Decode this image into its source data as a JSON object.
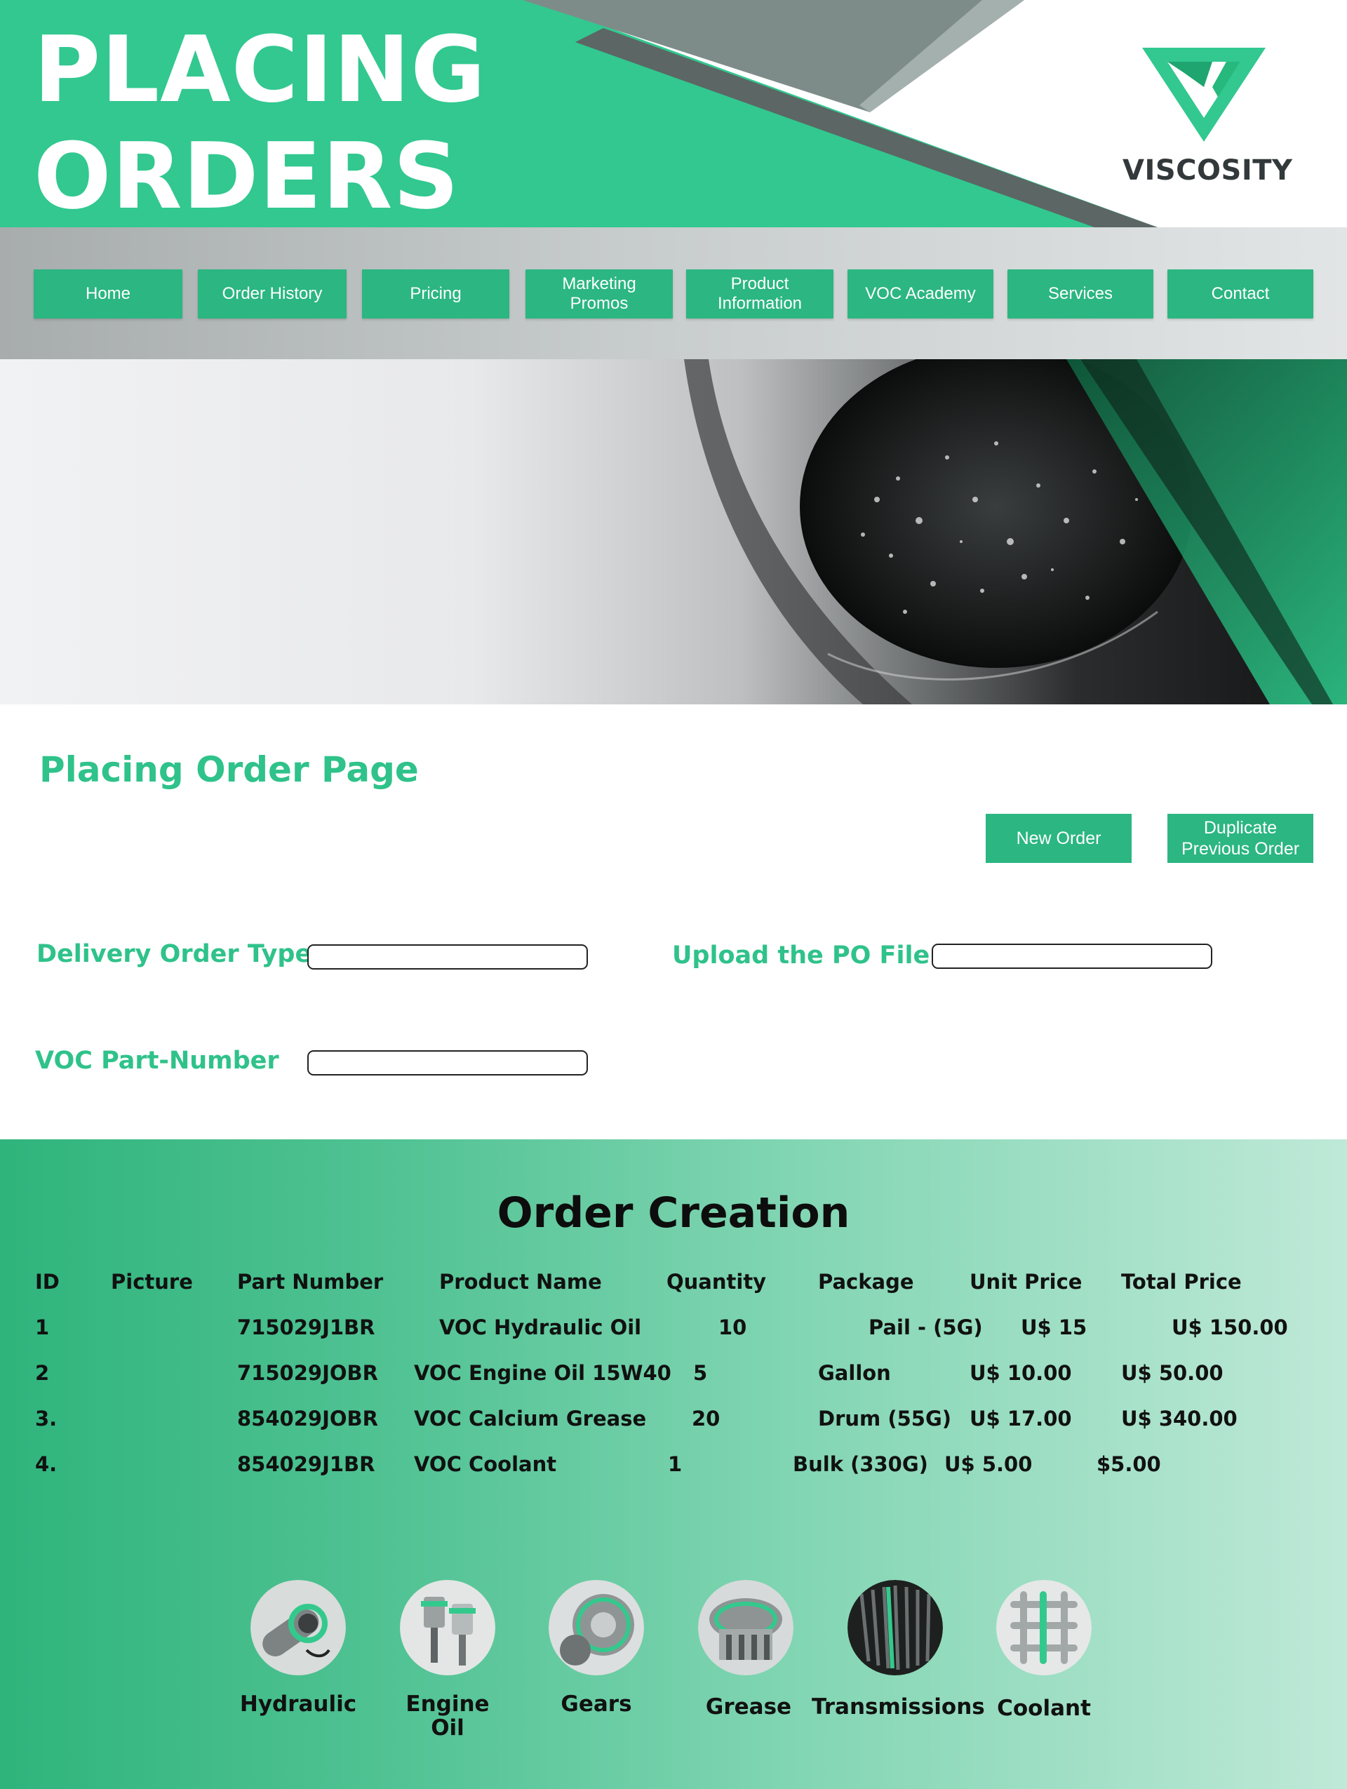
{
  "header": {
    "title_line1": "PLACING",
    "title_line2": "ORDERS",
    "brand": "VISCOSITY",
    "accent_color": "#32c890"
  },
  "nav": {
    "items": [
      {
        "label": "Home"
      },
      {
        "label": "Order History"
      },
      {
        "label": "Pricing"
      },
      {
        "label": "Marketing\nPromos"
      },
      {
        "label": "Product\nInformation"
      },
      {
        "label": "VOC Academy"
      },
      {
        "label": "Services"
      },
      {
        "label": "Contact"
      }
    ]
  },
  "form": {
    "page_title": "Placing Order Page",
    "new_order_label": "New Order",
    "duplicate_label": "Duplicate\nPrevious Order",
    "delivery_type_label": "Delivery Order Type",
    "delivery_type_value": "",
    "upload_po_label": "Upload the PO File",
    "upload_po_value": "",
    "part_number_label": "VOC Part-Number",
    "part_number_value": ""
  },
  "orders": {
    "title": "Order Creation",
    "columns": {
      "id": "ID",
      "picture": "Picture",
      "part_number": "Part Number",
      "product_name": "Product Name",
      "quantity": "Quantity",
      "package": "Package",
      "unit_price": "Unit Price",
      "total_price": "Total Price"
    },
    "rows": [
      {
        "id": "1",
        "part_number": "715029J1BR",
        "product_name": "VOC Hydraulic Oil",
        "quantity": "10",
        "package": "Pail - (5G)",
        "unit_price": "U$ 15",
        "total_price": "U$ 150.00"
      },
      {
        "id": "2",
        "part_number": "715029JOBR",
        "product_name": "VOC Engine Oil 15W40",
        "quantity": "5",
        "package": "Gallon",
        "unit_price": "U$ 10.00",
        "total_price": "U$ 50.00"
      },
      {
        "id": "3.",
        "part_number": "854029JOBR",
        "product_name": "VOC Calcium Grease",
        "quantity": "20",
        "package": "Drum (55G)",
        "unit_price": "U$ 17.00",
        "total_price": "U$ 340.00"
      },
      {
        "id": "4.",
        "part_number": "854029J1BR",
        "product_name": "VOC Coolant",
        "quantity": "1",
        "package": "Bulk (330G)",
        "unit_price": "U$ 5.00",
        "total_price": "$5.00"
      }
    ]
  },
  "categories": [
    {
      "label": "Hydraulic",
      "icon": "hydraulic-icon"
    },
    {
      "label": "Engine\nOil",
      "icon": "engine-oil-icon"
    },
    {
      "label": "Gears",
      "icon": "gears-icon"
    },
    {
      "label": "Grease",
      "icon": "grease-icon"
    },
    {
      "label": "Transmissions",
      "icon": "transmissions-icon"
    },
    {
      "label": "Coolant",
      "icon": "coolant-icon"
    }
  ]
}
